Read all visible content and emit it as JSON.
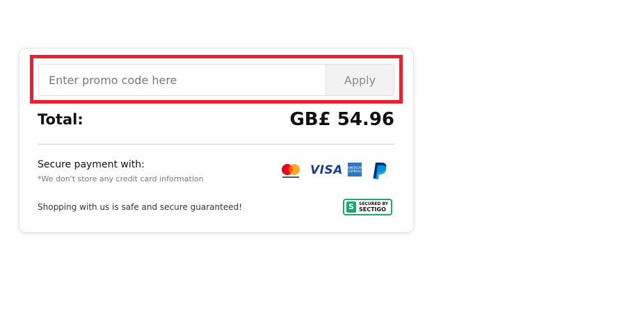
{
  "promo": {
    "placeholder": "Enter promo code here",
    "value": "",
    "apply_label": "Apply"
  },
  "total": {
    "label": "Total:",
    "amount": "GB£ 54.96"
  },
  "payment": {
    "title": "Secure payment with:",
    "note": "*We don't store any credit card information",
    "methods": [
      "mastercard-icon",
      "visa-icon",
      "amex-icon",
      "paypal-icon"
    ],
    "visa_text": "VISA",
    "amex_text": "AMERICAN EXPRESS"
  },
  "security": {
    "text": "Shopping with us is safe and secure guaranteed!",
    "badge_small": "SECURED BY",
    "badge_big": "SECTIGO",
    "badge_letter": "S"
  },
  "colors": {
    "highlight": "#e8202f",
    "sectigo_green": "#1aaa6a",
    "visa_blue": "#1a3d8f",
    "amex_blue": "#2e77bc",
    "paypal_dark": "#003087",
    "paypal_light": "#009cde",
    "mc_red": "#eb001b",
    "mc_orange": "#f79e1b"
  }
}
